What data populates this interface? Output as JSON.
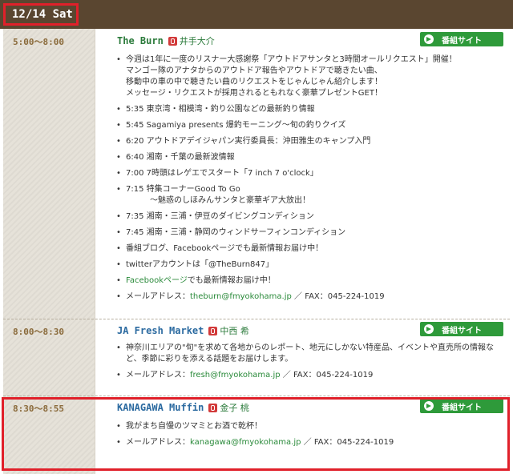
{
  "date": "12/14 Sat",
  "site_button_label": "番組サイト",
  "programs": [
    {
      "time": "5:00〜8:00",
      "title": "The Burn",
      "host": "井手大介",
      "items": [
        {
          "text": "今週は1年に一度のリスナー大感謝祭「アウトドアサンタと3時間オールリクエスト」開催！"
        },
        {
          "text": "マンゴー隊のアナタからのアウトドア報告やアウトドアで聴きたい曲、",
          "cont": true
        },
        {
          "text": "移動中の車の中で聴きたい曲のリクエストをじゃんじゃん紹介します！",
          "cont": true
        },
        {
          "text": "メッセージ・リクエストが採用されるともれなく豪華プレゼントGET！",
          "cont": true
        },
        {
          "text": "5:35 東京湾・相模湾・釣り公園などの最新釣り情報"
        },
        {
          "text": "5:45 Sagamiya presents 爆釣モーニング〜旬の釣りクイズ"
        },
        {
          "text": "6:20 アウトドアデイジャパン実行委員長：沖田雅生のキャンプ入門"
        },
        {
          "text": "6:40 湘南・千葉の最新波情報"
        },
        {
          "text": "7:00 7時頭はレゲエでスタート「7 inch 7 o'clock」"
        },
        {
          "text": "7:15 特集コーナーGood To Go"
        },
        {
          "text": "〜魅惑のしほみんサンタと豪華ギア大放出！",
          "cont": true,
          "indent": true
        },
        {
          "text": "7:35 湘南・三浦・伊豆のダイビングコンディション"
        },
        {
          "text": "7:45 湘南・三浦・静岡のウィンドサーフィンコンディション"
        },
        {
          "text": "番組ブログ、Facebookページでも最新情報お届け中！"
        },
        {
          "text": "twitterアカウントは「@TheBurn847」"
        },
        {
          "link": "Facebookページ",
          "text": "でも最新情報お届け中！"
        },
        {
          "text": "メールアドレス：",
          "email": "theburn@fmyokohama.jp",
          "fax": " ／ FAX：045-224-1019"
        }
      ]
    },
    {
      "time": "8:00〜8:30",
      "title": "JA Fresh Market",
      "host": "中西 希",
      "items": [
        {
          "text": "神奈川エリアの\"旬\"を求めて各地からのレポート、地元にしかない特産品、イベントや直売所の情報な"
        },
        {
          "text": "ど、季節に彩りを添える話題をお届けします。",
          "cont": true
        },
        {
          "text": "メールアドレス：",
          "email": "fresh@fmyokohama.jp",
          "fax": " ／ FAX：045-224-1019"
        }
      ]
    },
    {
      "time": "8:30〜8:55",
      "title": "KANAGAWA Muffin",
      "host": "金子 桃",
      "items": [
        {
          "text": "我がまち自慢のツマミとお酒で乾杯！"
        },
        {
          "text": "メールアドレス：",
          "email": "kanagawa@fmyokohama.jp",
          "fax": " ／ FAX：045-224-1019"
        }
      ]
    }
  ]
}
